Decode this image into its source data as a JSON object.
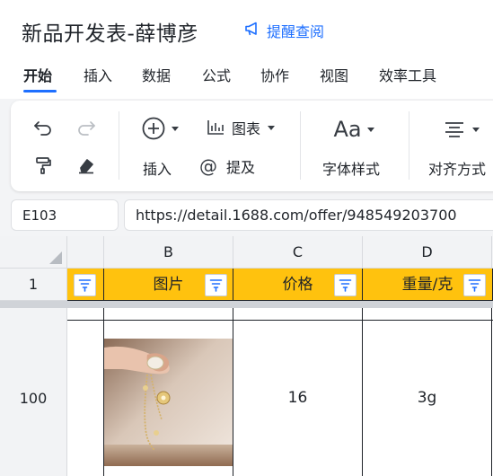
{
  "doc": {
    "title": "新品开发表-薛博彦",
    "remind_label": "提醒查阅"
  },
  "menu": [
    {
      "label": "开始",
      "active": true
    },
    {
      "label": "插入"
    },
    {
      "label": "数据"
    },
    {
      "label": "公式"
    },
    {
      "label": "协作"
    },
    {
      "label": "视图"
    },
    {
      "label": "效率工具"
    }
  ],
  "toolbar": {
    "insert_label": "插入",
    "chart_label": "图表",
    "mention_label": "提及",
    "font_style_label": "字体样式",
    "align_label": "对齐方式",
    "font_glyph": "Aa"
  },
  "formula_bar": {
    "cell_ref": "E103",
    "value": "https://detail.1688.com/offer/948549203700"
  },
  "sheet": {
    "columns": [
      "B",
      "C",
      "D"
    ],
    "header_row_number": "1",
    "headers": [
      "图片",
      "价格",
      "重量/克"
    ],
    "data_row_number": "100",
    "row": {
      "price": "16",
      "weight": "3g"
    },
    "accent_color": "#ffc20e",
    "link_color": "#1e6fff"
  }
}
